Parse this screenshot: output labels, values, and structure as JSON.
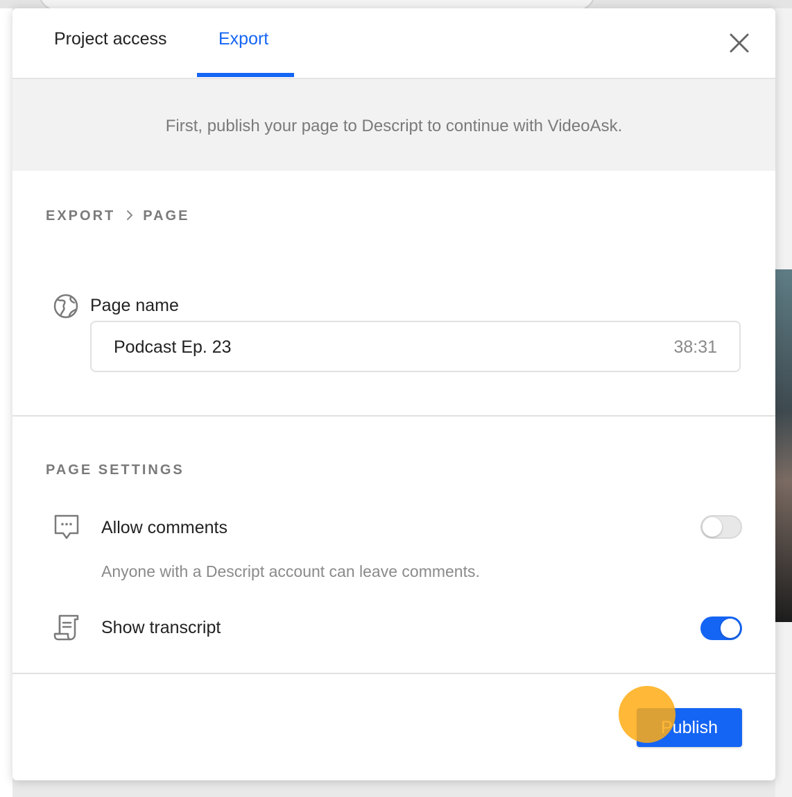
{
  "tabs": [
    {
      "label": "Project access"
    },
    {
      "label": "Export"
    }
  ],
  "banner": {
    "text": "First, publish your page to Descript to continue with VideoAsk."
  },
  "breadcrumb": {
    "root": "EXPORT",
    "current": "PAGE"
  },
  "page_name": {
    "label": "Page name",
    "value": "Podcast Ep. 23",
    "duration": "38:31"
  },
  "page_settings": {
    "heading": "PAGE SETTINGS",
    "allow_comments": {
      "label": "Allow comments",
      "description": "Anyone with a Descript account can leave comments.",
      "enabled": false
    },
    "show_transcript": {
      "label": "Show transcript",
      "enabled": true
    }
  },
  "footer": {
    "publish_label": "Publish"
  },
  "colors": {
    "accent": "#1565f4",
    "cursor": "#ffac14"
  },
  "icons": [
    "close-icon",
    "globe-icon",
    "comment-icon",
    "transcript-icon",
    "chevron-right-icon"
  ]
}
